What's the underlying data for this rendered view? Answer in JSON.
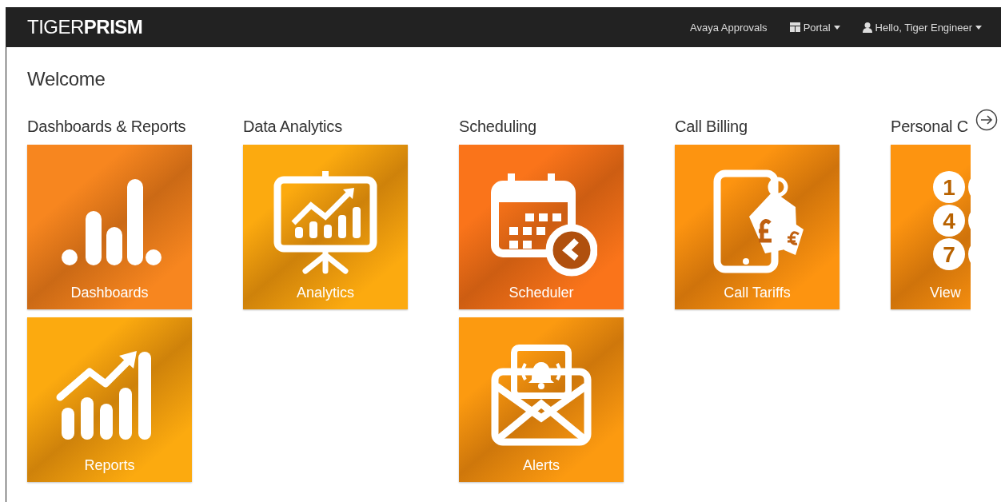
{
  "navbar": {
    "logo": "TIGER**PRISM**",
    "links": [
      {
        "label": "Avaya Approvals",
        "kind": "link"
      },
      {
        "label": "Portal",
        "kind": "portal-menu"
      },
      {
        "label": "Hello, Tiger Engineer",
        "kind": "user-menu"
      }
    ]
  },
  "page_title": "Welcome",
  "sections": [
    {
      "title": "Dashboards & Reports",
      "tiles": [
        {
          "label": "Dashboards",
          "kind": "bars",
          "color": "#f7861f"
        },
        {
          "label": "Reports",
          "kind": "trend",
          "color": "#fcaa0f"
        }
      ]
    },
    {
      "title": "Data Analytics",
      "tiles": [
        {
          "label": "Analytics",
          "kind": "presentation",
          "color": "#fcaa0f"
        }
      ]
    },
    {
      "title": "Scheduling",
      "tiles": [
        {
          "label": "Scheduler",
          "kind": "calendar",
          "color": "#fa741a"
        },
        {
          "label": "Alerts",
          "kind": "envelope",
          "color": "#fc9a10"
        }
      ]
    },
    {
      "title": "Call Billing",
      "tiles": [
        {
          "label": "Call Tariffs",
          "kind": "tablet",
          "color": "#fd9410"
        }
      ]
    },
    {
      "title": "Personal C",
      "tiles": [
        {
          "label": "View",
          "kind": "keypad",
          "keys": [
            "1",
            "4",
            "7"
          ],
          "color": "#fd9410"
        }
      ]
    }
  ]
}
